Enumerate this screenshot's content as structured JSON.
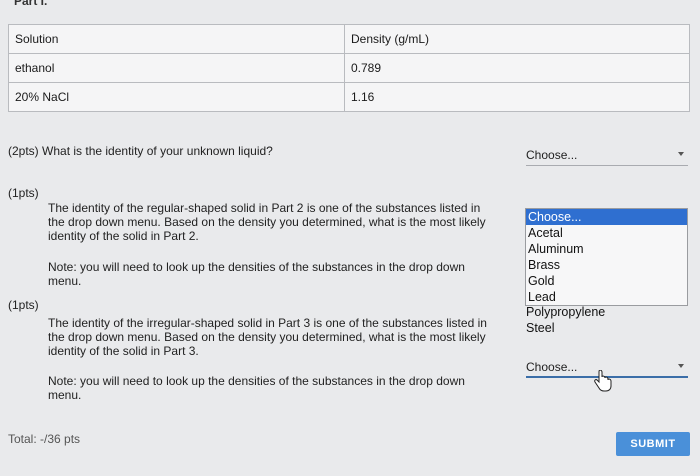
{
  "header": {
    "part_label": "Part I."
  },
  "table": {
    "columns": [
      "Solution",
      "Density (g/mL)"
    ],
    "rows": [
      [
        "ethanol",
        "0.789"
      ],
      [
        "20% NaCl",
        "1.16"
      ]
    ]
  },
  "q1": {
    "pts": "(2pts)",
    "text": "What is the identity of your unknown liquid?",
    "select_value": "Choose..."
  },
  "q2": {
    "pts": "(1pts)",
    "line1": "The identity of the regular-shaped solid in Part 2 is one of the substances listed in",
    "line2": "the drop down menu. Based on the density you determined, what is the most likely",
    "line3": "identity of the solid in Part 2.",
    "note1": "Note: you will need to look up the densities of the substances in the drop down",
    "note2": "menu.",
    "options": [
      "Choose...",
      "Acetal",
      "Aluminum",
      "Brass",
      "Gold",
      "Lead",
      "Polypropylene",
      "Steel"
    ]
  },
  "q3": {
    "pts": "(1pts)",
    "line1": "The identity of the irregular-shaped solid in Part 3 is one of the substances listed in",
    "line2": "the drop down menu. Based on the density you determined, what is the most likely",
    "line3": "identity of the solid in Part 3.",
    "note1": "Note: you will need to look up the densities of the substances in the drop down",
    "note2": "menu.",
    "select_value": "Choose..."
  },
  "footer": {
    "total": "Total: -/36 pts",
    "submit_label": "SUBMIT"
  }
}
